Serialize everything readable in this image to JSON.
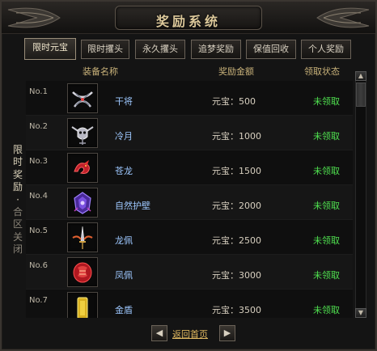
{
  "window": {
    "title": "奖励系统"
  },
  "tabs": [
    {
      "label": "限时元宝",
      "active": true
    },
    {
      "label": "限时攫头",
      "active": false
    },
    {
      "label": "永久攫头",
      "active": false
    },
    {
      "label": "追梦奖励",
      "active": false
    },
    {
      "label": "保值回收",
      "active": false
    },
    {
      "label": "个人奖励",
      "active": false
    }
  ],
  "columns": {
    "equipment": "装备名称",
    "amount": "奖励金额",
    "status": "领取状态"
  },
  "side_label": {
    "main": "限时奖励",
    "dot": "·",
    "sub": "合区关闭"
  },
  "rows": [
    {
      "no": "No.1",
      "name": "干将",
      "amount": "元宝：500",
      "status": "未领取",
      "icon": "bow-icon"
    },
    {
      "no": "No.2",
      "name": "冷月",
      "amount": "元宝：1000",
      "status": "未领取",
      "icon": "skull-blade-icon"
    },
    {
      "no": "No.3",
      "name": "苍龙",
      "amount": "元宝：1500",
      "status": "未领取",
      "icon": "red-dragon-icon"
    },
    {
      "no": "No.4",
      "name": "自然护壁",
      "amount": "元宝：2000",
      "status": "未领取",
      "icon": "purple-shield-icon"
    },
    {
      "no": "No.5",
      "name": "龙佩",
      "amount": "元宝：2500",
      "status": "未领取",
      "icon": "winged-sword-icon"
    },
    {
      "no": "No.6",
      "name": "凤佩",
      "amount": "元宝：3000",
      "status": "未领取",
      "icon": "red-phoenix-icon"
    },
    {
      "no": "No.7",
      "name": "金盾",
      "amount": "元宝：3500",
      "status": "未领取",
      "icon": "gold-shield-icon"
    }
  ],
  "pager": {
    "prev": "◀",
    "label": "返回首页",
    "next": "▶"
  },
  "scroll": {
    "up": "▲",
    "down": "▼"
  },
  "colors": {
    "status": "#4fe04f",
    "name": "#9ec8ff",
    "header": "#c9b27a",
    "link": "#e0b860"
  }
}
